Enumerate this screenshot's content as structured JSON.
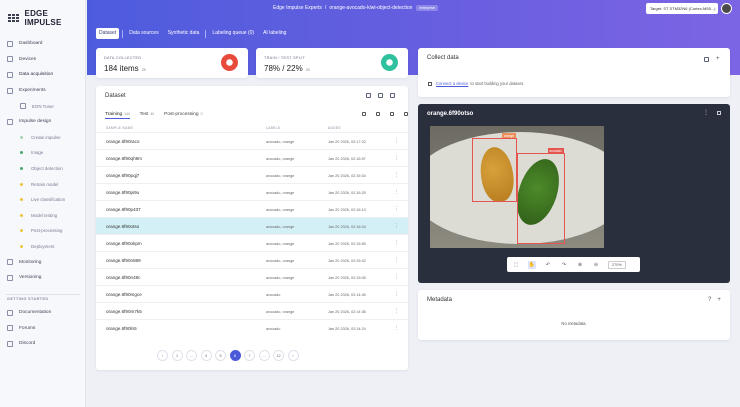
{
  "app": {
    "name": "EDGE IMPULSE"
  },
  "header": {
    "breadcrumb_org": "Edge Impulse Experts",
    "breadcrumb_sep": "/",
    "breadcrumb_project": "orange-avocado-kiwi-object-detection",
    "project_badge": "enterprise",
    "target_label": "Target: ST STM32N6 (Cortex-M55...)"
  },
  "sidebar": {
    "items": [
      {
        "label": "Dashboard",
        "icon": "dashboard-icon"
      },
      {
        "label": "Devices",
        "icon": "devices-icon"
      },
      {
        "label": "Data acquisition",
        "icon": "database-icon"
      },
      {
        "label": "Experiments",
        "icon": "experiments-icon"
      },
      {
        "label": "EON Tuner",
        "icon": "tuner-icon",
        "sub": true
      },
      {
        "label": "Impulse design",
        "icon": "impulse-icon"
      },
      {
        "label": "Create impulse",
        "sub": true,
        "color": "#a8d4b0"
      },
      {
        "label": "Image",
        "sub": true,
        "color": "#46a86a"
      },
      {
        "label": "Object detection",
        "sub": true,
        "color": "#46a86a"
      },
      {
        "label": "Retrain model",
        "sub": true,
        "color": "#e8c640"
      },
      {
        "label": "Live classification",
        "sub": true,
        "color": "#e8c640"
      },
      {
        "label": "Model testing",
        "sub": true,
        "color": "#e8c640"
      },
      {
        "label": "Post-processing",
        "sub": true,
        "color": "#e8c640"
      },
      {
        "label": "Deployment",
        "sub": true,
        "color": "#e8c640"
      },
      {
        "label": "Monitoring",
        "icon": "monitoring-icon"
      },
      {
        "label": "Versioning",
        "icon": "versioning-icon"
      }
    ],
    "getting_started_heading": "GETTING STARTED",
    "getting_started": [
      {
        "label": "Documentation",
        "icon": "docs-icon"
      },
      {
        "label": "Forums",
        "icon": "forums-icon"
      },
      {
        "label": "Discord",
        "icon": "discord-icon"
      }
    ]
  },
  "tabs": [
    {
      "label": "Dataset",
      "active": true
    },
    {
      "label": "Data sources"
    },
    {
      "label": "Synthetic data"
    },
    {
      "label": "Labeling queue (0)"
    },
    {
      "label": "AI labeling"
    }
  ],
  "stats": {
    "collected_label": "DATA COLLECTED",
    "collected_value": "184 items",
    "collected_extra": "28",
    "split_label": "TRAIN / TEST SPLIT",
    "split_value": "78% / 22%",
    "split_extra": "28",
    "collected_color": "#e84b3c",
    "split_color": "#2fc09d"
  },
  "collect": {
    "title": "Collect data",
    "link": "Connect a device",
    "text": "to start building your dataset."
  },
  "dataset": {
    "title": "Dataset",
    "subtabs": [
      {
        "label": "Training",
        "count": "144",
        "active": true
      },
      {
        "label": "Test",
        "count": "40"
      },
      {
        "label": "Post-processing",
        "count": "0"
      }
    ],
    "columns": [
      "SAMPLE NAME",
      "LABELS",
      "ADDED"
    ],
    "rows": [
      {
        "name": "orange.6f90raco",
        "labels": "avocado, orange",
        "added": "Jan 20 2026, 02:17:22"
      },
      {
        "name": "orange.6f90qh9m",
        "labels": "avocado, orange",
        "added": "Jan 20 2026, 02:16:57"
      },
      {
        "name": "orange.6f90pqj7",
        "labels": "avocado, orange",
        "added": "Jan 20 2026, 02:16:34"
      },
      {
        "name": "orange.6f90pi9u",
        "labels": "avocado, orange",
        "added": "Jan 20 2026, 02:16:25"
      },
      {
        "name": "orange.6f90p437",
        "labels": "avocado, orange",
        "added": "Jan 20 2026, 02:16:13"
      },
      {
        "name": "orange.6f90otso",
        "labels": "avocado, orange",
        "added": "Jan 20 2026, 02:16:04",
        "selected": true
      },
      {
        "name": "orange.6f90okpm",
        "labels": "avocado, orange",
        "added": "Jan 20 2026, 02:15:55"
      },
      {
        "name": "orange.6f90n869",
        "labels": "avocado, orange",
        "added": "Jan 20 2026, 02:15:42"
      },
      {
        "name": "orange.6f90n49c",
        "labels": "avocado, orange",
        "added": "Jan 20 2026, 02:15:05"
      },
      {
        "name": "orange.6f90mgce",
        "labels": "avocado",
        "added": "Jan 20 2026, 02:14:45"
      },
      {
        "name": "orange.6f90m7k5",
        "labels": "avocado, orange",
        "added": "Jan 20 2026, 02:14:36"
      },
      {
        "name": "orange.6f90ln5",
        "labels": "avocado",
        "added": "Jan 20 2026, 02:14:24"
      }
    ],
    "pages": [
      "‹",
      "1",
      "...",
      "4",
      "5",
      "6",
      "7",
      "...",
      "12",
      "›"
    ],
    "current_page": "6"
  },
  "preview": {
    "title": "orange.6f90otso",
    "box_orange": "orange",
    "box_avocado": "avocado",
    "zoom": "270%"
  },
  "metadata": {
    "title": "Metadata",
    "empty": "No metadata.",
    "help": "?",
    "add": "+"
  }
}
